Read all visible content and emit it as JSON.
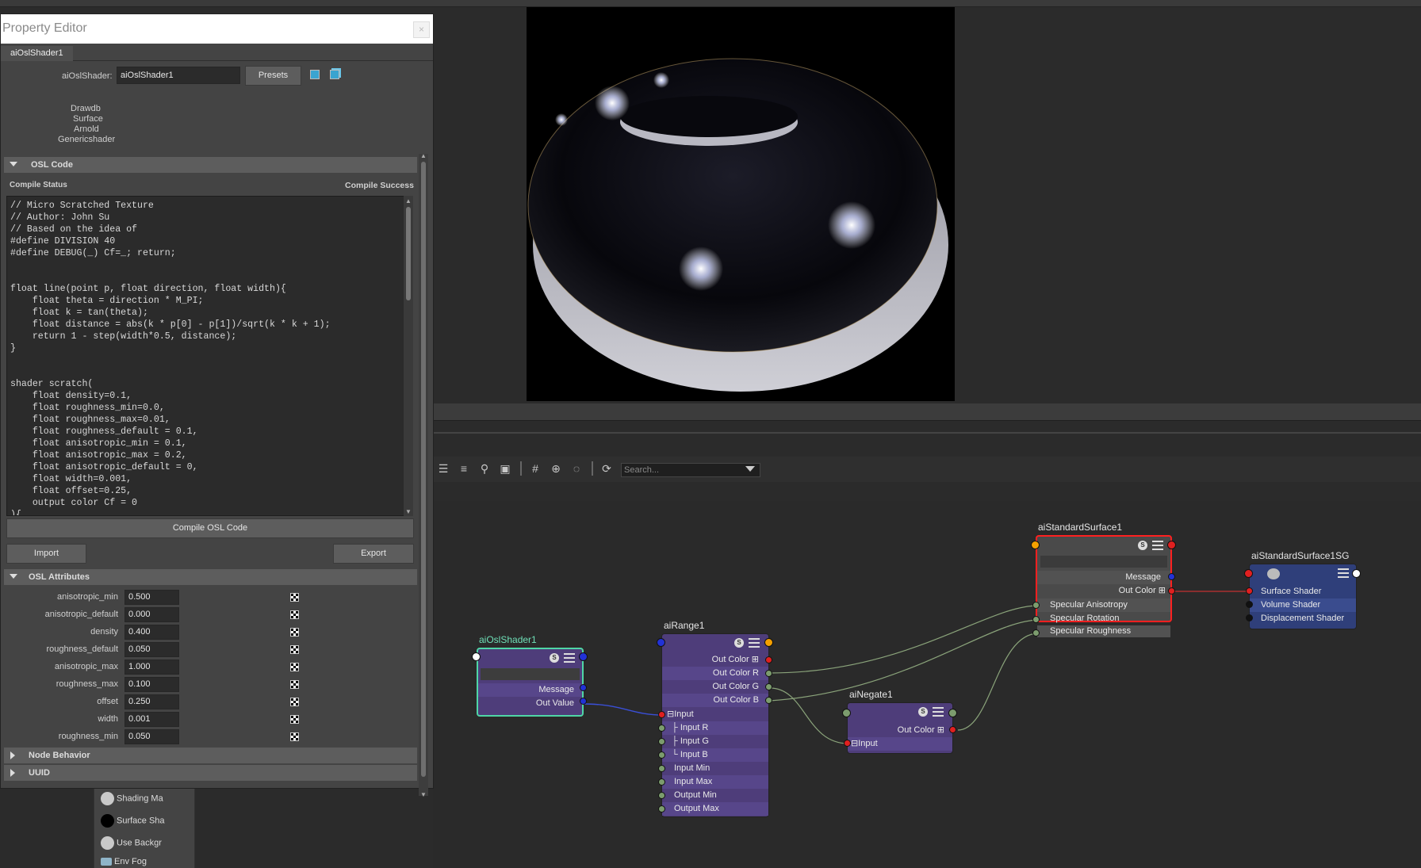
{
  "property_editor": {
    "title": "Property Editor",
    "close_glyph": "×",
    "tab": "aiOslShader1",
    "node_type_label": "aiOslShader:",
    "node_name": "aiOslShader1",
    "presets_label": "Presets",
    "classification": [
      "Drawdb",
      "Surface",
      "Arnold",
      "Genericshader"
    ],
    "osl_code_section": "OSL Code",
    "compile_status_label": "Compile Status",
    "compile_status_value": "Compile Success",
    "code_lines": [
      "// Micro Scratched Texture",
      "// Author: John Su",
      "// Based on the idea of",
      "#define DIVISION 40",
      "#define DEBUG(_) Cf=_; return;",
      "",
      "",
      "float line(point p, float direction, float width){",
      "    float theta = direction * M_PI;",
      "    float k = tan(theta);",
      "    float distance = abs(k * p[0] - p[1])/sqrt(k * k + 1);",
      "    return 1 - step(width*0.5, distance);",
      "}",
      "",
      "",
      "shader scratch(",
      "    float density=0.1,",
      "    float roughness_min=0.0,",
      "    float roughness_max=0.01,",
      "    float roughness_default = 0.1,",
      "    float anisotropic_min = 0.1,",
      "    float anisotropic_max = 0.2,",
      "    float anisotropic_default = 0,",
      "    float width=0.001,",
      "    float offset=0.25,",
      "    output color Cf = 0",
      "){"
    ],
    "compile_button": "Compile OSL Code",
    "import_button": "Import",
    "export_button": "Export",
    "osl_attributes_section": "OSL Attributes",
    "attributes": [
      {
        "name": "anisotropic_min",
        "value": "0.500"
      },
      {
        "name": "anisotropic_default",
        "value": "0.000"
      },
      {
        "name": "density",
        "value": "0.400"
      },
      {
        "name": "roughness_default",
        "value": "0.050"
      },
      {
        "name": "anisotropic_max",
        "value": "1.000"
      },
      {
        "name": "roughness_max",
        "value": "0.100"
      },
      {
        "name": "offset",
        "value": "0.250"
      },
      {
        "name": "width",
        "value": "0.001"
      },
      {
        "name": "roughness_min",
        "value": "0.050"
      }
    ],
    "node_behavior_section": "Node Behavior",
    "uuid_section": "UUID"
  },
  "attribute_editor_remnant": {
    "rows": [
      "Shading Ma",
      "Surface Sha",
      "Use Backgr",
      "Env Fog"
    ]
  },
  "graph_toolbar": {
    "search_placeholder": "Search..."
  },
  "nodes": {
    "osl": {
      "title": "aiOslShader1",
      "header_icon": "S",
      "ports": [
        "Message",
        "Out Value"
      ]
    },
    "range": {
      "title": "aiRange1",
      "header_icon": "S",
      "outputs": [
        "Out Color",
        "Out Color R",
        "Out Color G",
        "Out Color B"
      ],
      "inputs": [
        "Input",
        "Input R",
        "Input G",
        "Input B",
        "Input Min",
        "Input Max",
        "Output Min",
        "Output Max"
      ]
    },
    "negate": {
      "title": "aiNegate1",
      "header_icon": "S",
      "outputs": [
        "Out Color"
      ],
      "inputs": [
        "Input"
      ]
    },
    "surface": {
      "title": "aiStandardSurface1",
      "header_icon": "S",
      "outputs": [
        "Message",
        "Out Color"
      ],
      "inputs": [
        "Specular Anisotropy",
        "Specular Rotation",
        "Specular Roughness"
      ]
    },
    "sg": {
      "title": "aiStandardSurface1SG",
      "inputs": [
        "Surface Shader",
        "Volume Shader",
        "Displacement Shader"
      ]
    }
  },
  "colors": {
    "osl_border": "#4fd6a6",
    "surface_border": "#ff2020",
    "node_purple": "#4e3d7a",
    "node_sg_blue": "#2f3f7a"
  }
}
